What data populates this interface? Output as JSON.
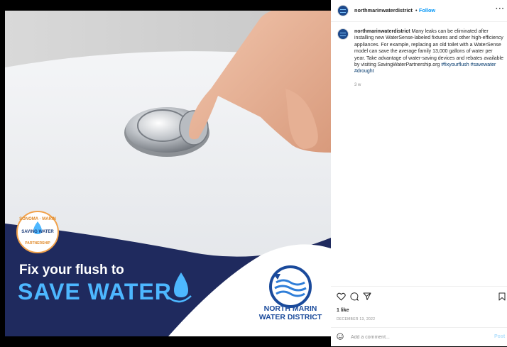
{
  "post": {
    "image": {
      "headline_line1": "Fix your flush to",
      "headline_line2": "SAVE WATER",
      "brand_name": "NORTH MARIN WATER DISTRICT",
      "badge_top": "SONOMA · MARIN",
      "badge_middle": "SAVING WATER",
      "badge_bottom": "PARTNERSHIP",
      "colors": {
        "navy": "#1f2a5e",
        "accent_blue": "#4db7ff",
        "badge_orange": "#f1a24c"
      }
    }
  },
  "header": {
    "username": "northmarinwaterdistrict",
    "separator": "•",
    "follow_label": "Follow",
    "more_label": "···"
  },
  "caption": {
    "username": "northmarinwaterdistrict",
    "text": "Many leaks can be eliminated after installing new WaterSense-labeled fixtures and other high-efficiency appliances. For example, replacing an old toilet with a WaterSense model can save the average family 13,000 gallons of water per year. Take advantage of water-saving devices and rebates available by visiting SavingWaterPartnership.org",
    "hashtags": [
      "#fixyourflush",
      "#savewater",
      "#drought"
    ],
    "time_ago": "3 w"
  },
  "actions": {
    "icons": [
      "heart-icon",
      "comment-icon",
      "share-icon",
      "bookmark-icon"
    ],
    "likes": "1 like",
    "date": "DECEMBER 13, 2022"
  },
  "comment": {
    "placeholder": "Add a comment...",
    "post_label": "Post"
  },
  "colors": {
    "link_blue": "#0095f6",
    "hashtag_blue": "#00376b",
    "muted": "#8e8e8e"
  }
}
